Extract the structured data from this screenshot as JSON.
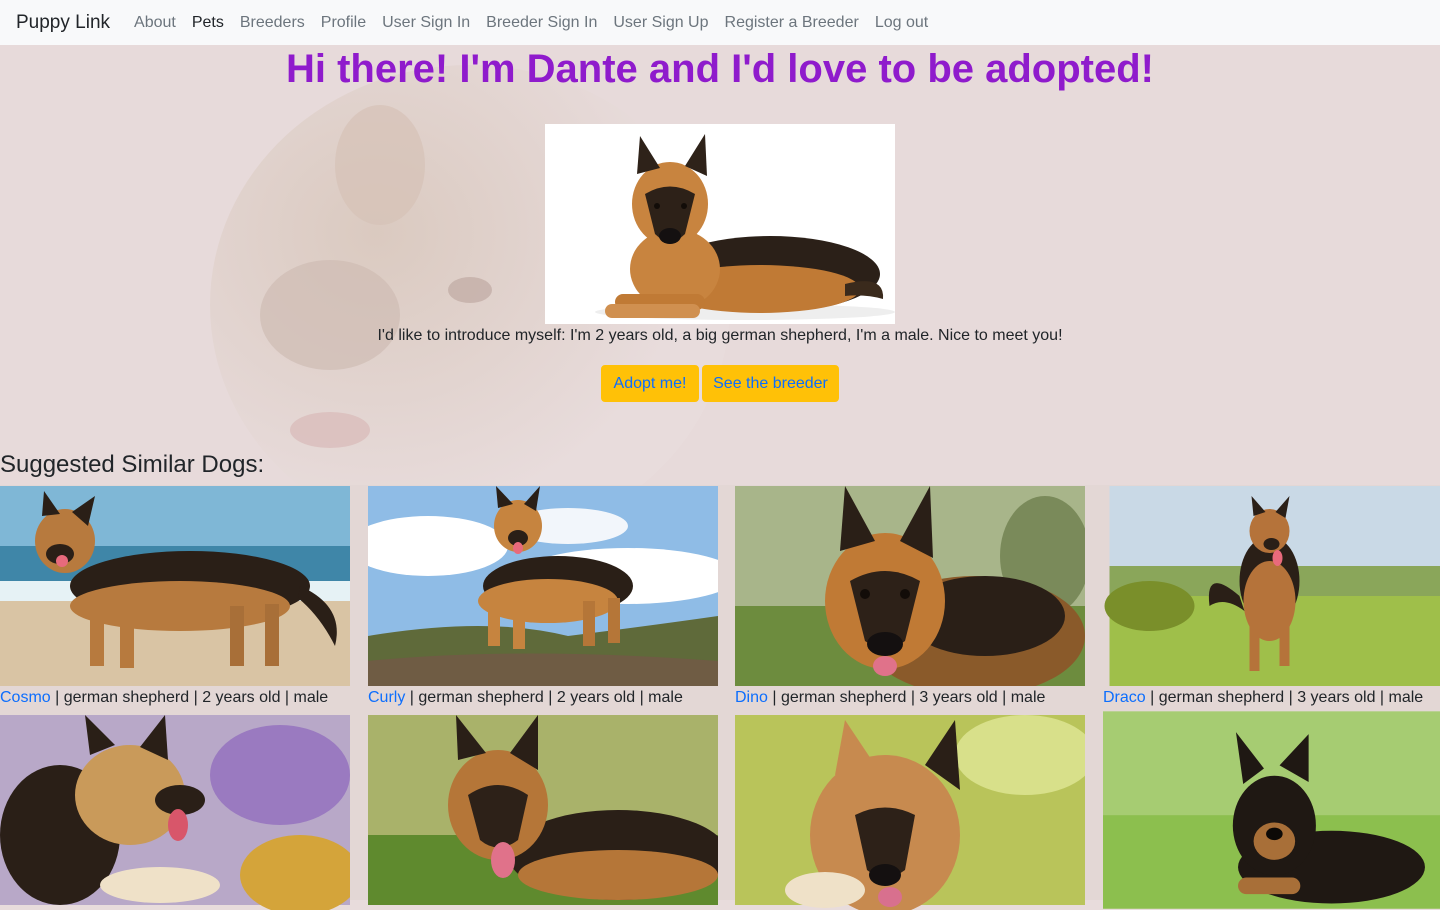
{
  "nav": {
    "brand": "Puppy Link",
    "links": [
      {
        "label": "About"
      },
      {
        "label": "Pets"
      },
      {
        "label": "Breeders"
      },
      {
        "label": "Profile"
      },
      {
        "label": "User Sign In"
      },
      {
        "label": "Breeder Sign In"
      },
      {
        "label": "User Sign Up"
      },
      {
        "label": "Register a Breeder"
      },
      {
        "label": "Log out"
      }
    ],
    "active": "Pets"
  },
  "hero": {
    "title": "Hi there! I'm Dante and I'd love to be adopted!",
    "intro": "I'd like to introduce myself: I'm 2 years old, a big german shepherd, I'm a male. Nice to meet you!",
    "adopt_label": "Adopt me!",
    "breeder_label": "See the breeder"
  },
  "suggestions": {
    "title": "Suggested Similar Dogs:",
    "dogs": [
      {
        "name": "Cosmo",
        "details": " | german shepherd | 2 years old | male"
      },
      {
        "name": "Curly",
        "details": " | german shepherd | 2 years old | male"
      },
      {
        "name": "Dino",
        "details": " | german shepherd | 3 years old | male"
      },
      {
        "name": "Draco",
        "details": " | german shepherd | 3 years old | male"
      },
      {
        "name": "",
        "details": ""
      },
      {
        "name": "",
        "details": ""
      },
      {
        "name": "",
        "details": ""
      },
      {
        "name": "",
        "details": ""
      }
    ]
  },
  "colors": {
    "title": "#8f1bcc",
    "button": "#ffc107",
    "link": "#0d6efd",
    "navbar": "#f8f9fa",
    "page_background": "#e8dcdc"
  }
}
